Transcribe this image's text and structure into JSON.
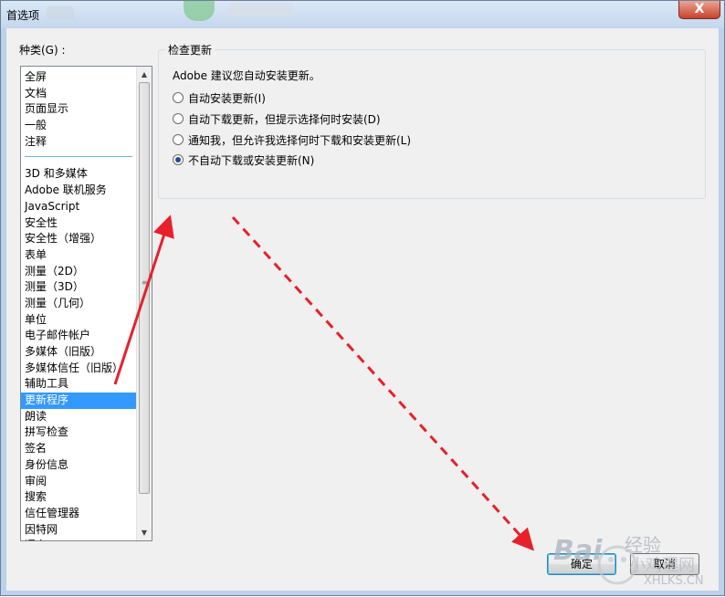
{
  "window": {
    "title": "首选项",
    "close_label": "X"
  },
  "categories": {
    "label": "种类(G) :",
    "group1": [
      "全屏",
      "文档",
      "页面显示",
      "一般",
      "注释"
    ],
    "group2": [
      "3D 和多媒体",
      "Adobe 联机服务",
      "JavaScript",
      "安全性",
      "安全性（增强）",
      "表单",
      "测量（2D）",
      "测量（3D）",
      "测量（几何）",
      "单位",
      "电子邮件帐户",
      "多媒体（旧版）",
      "多媒体信任（旧版）",
      "辅助工具",
      "更新程序",
      "朗读",
      "拼写检查",
      "签名",
      "身份信息",
      "审阅",
      "搜索",
      "信任管理器",
      "因特网",
      "语言"
    ],
    "selected": "更新程序"
  },
  "updater": {
    "group_title": "检查更新",
    "description": "Adobe 建议您自动安装更新。",
    "options": [
      {
        "label": "自动安装更新(I)",
        "checked": false
      },
      {
        "label": "自动下载更新，但提示选择何时安装(D)",
        "checked": false
      },
      {
        "label": "通知我，但允许我选择何时下载和安装更新(L)",
        "checked": false
      },
      {
        "label": "不自动下载或安装更新(N)",
        "checked": true
      }
    ]
  },
  "buttons": {
    "ok": "确定",
    "cancel": "取消"
  },
  "annotations": {
    "arrow_color": "#e8202a"
  },
  "watermark": {
    "baidu": "Bai",
    "jingyan": "经验",
    "site_cn": "小鸡理网",
    "site_en": "XHLKS.CN"
  }
}
